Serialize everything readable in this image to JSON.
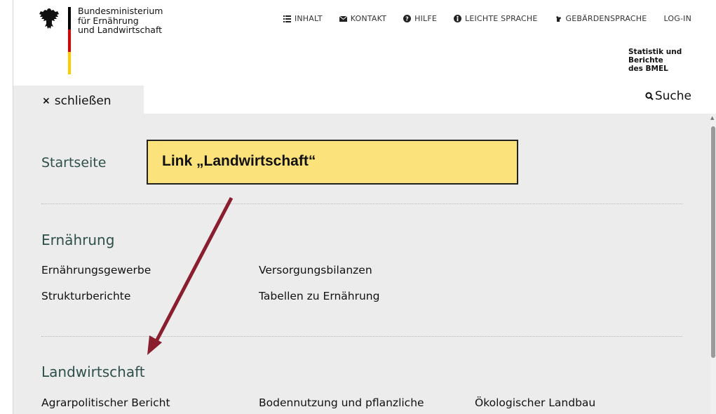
{
  "header": {
    "ministry_lines": [
      "Bundesministerium",
      "für Ernährung",
      "und Landwirtschaft"
    ],
    "subtitle_lines": [
      "Statistik und Berichte",
      "des BMEL"
    ],
    "topnav": [
      {
        "label": "INHALT",
        "icon": "list-icon"
      },
      {
        "label": "KONTAKT",
        "icon": "envelope-icon"
      },
      {
        "label": "HILFE",
        "icon": "help-icon"
      },
      {
        "label": "LEICHTE SPRACHE",
        "icon": "easy-language-icon"
      },
      {
        "label": "GEBÄRDENSPRACHE",
        "icon": "sign-language-icon"
      },
      {
        "label": "LOG-IN",
        "icon": ""
      }
    ]
  },
  "menu": {
    "close_label": "schließen",
    "close_icon": "×",
    "search_label": "Suche"
  },
  "sections": {
    "home": "Startseite",
    "nutrition": {
      "title": "Ernährung",
      "links": [
        "Ernährungsgewerbe",
        "Versorgungsbilanzen",
        "Strukturberichte",
        "Tabellen zu Ernährung"
      ]
    },
    "agriculture": {
      "title": "Landwirtschaft",
      "links": [
        "Agrarpolitischer Bericht",
        "Bodennutzung und pflanzliche",
        "Ökologischer Landbau"
      ]
    }
  },
  "annotation": {
    "callout": "Link „Landwirtschaft“"
  },
  "colors": {
    "flag_black": "#000000",
    "flag_red": "#dd0000",
    "flag_gold": "#ffcc00",
    "heading": "#2f4f4a",
    "panel": "#ececec",
    "callout": "#fbe27a",
    "arrow": "#8b1e2e"
  }
}
